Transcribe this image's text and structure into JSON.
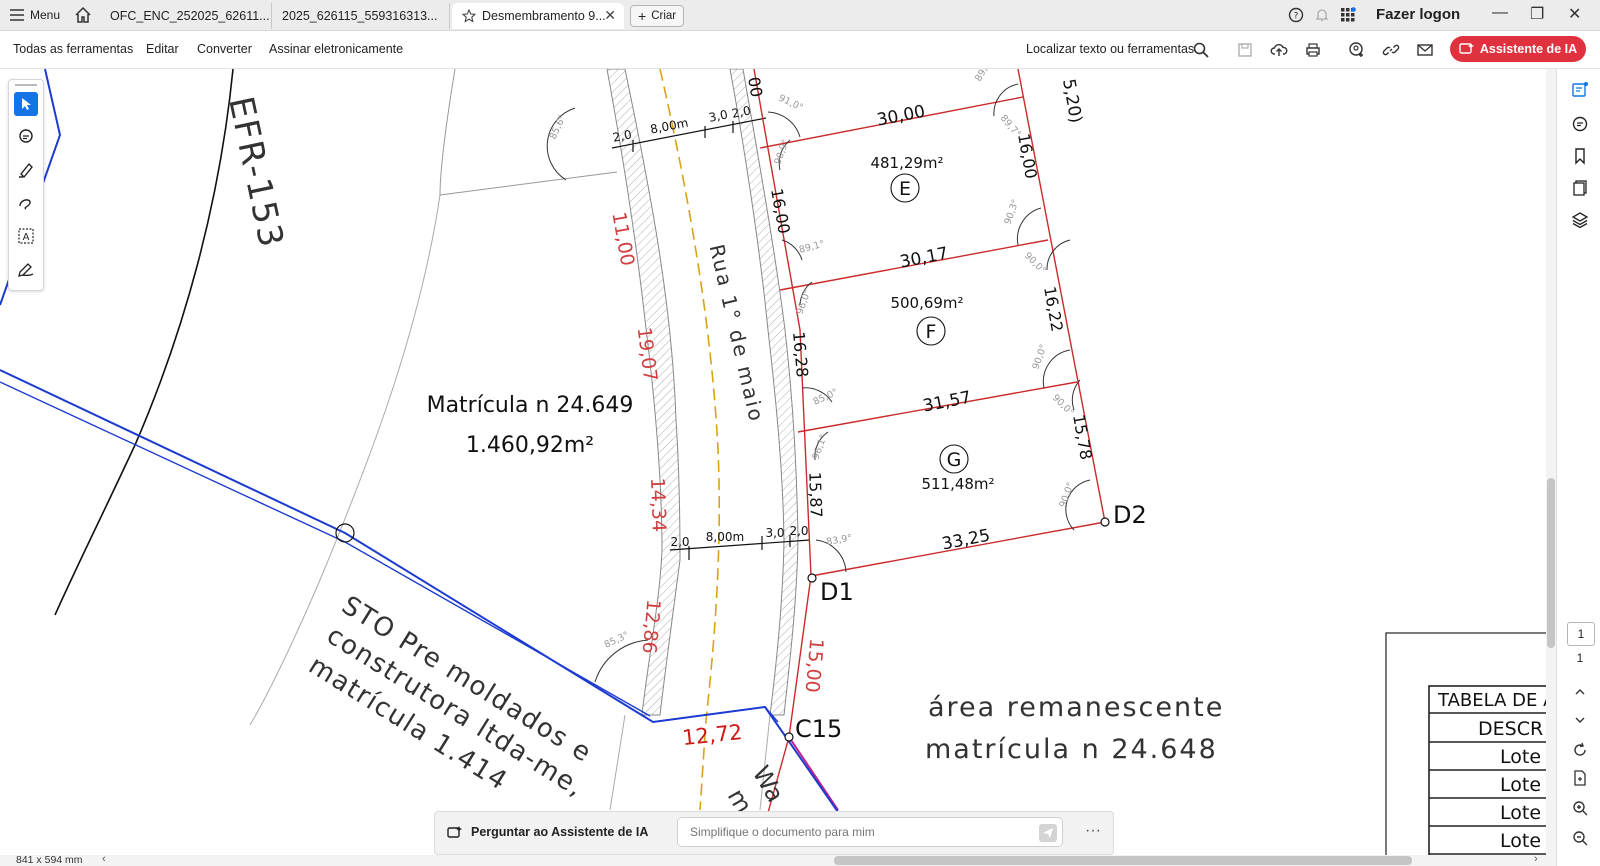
{
  "tabs": {
    "menu_label": "Menu",
    "items": [
      {
        "label": "OFC_ENC_252025_62611..."
      },
      {
        "label": "2025_626115_559316313..."
      },
      {
        "label": "Desmembramento 9..."
      }
    ],
    "new_tab_label": "Criar"
  },
  "account": {
    "login_label": "Fazer logon"
  },
  "toolbar": {
    "all_tools": "Todas as ferramentas",
    "edit": "Editar",
    "convert": "Converter",
    "sign": "Assinar eletronicamente",
    "find_label": "Localizar texto ou ferramentas",
    "ai_assistant": "Assistente de IA"
  },
  "drawing": {
    "road_label": "Rua 1° de maio",
    "left_parcel": {
      "title": "Matrícula n 24.649",
      "area": "1.460,92m²"
    },
    "efr": "EFR-153",
    "sto_lines": [
      "STO Pre moldados e",
      "construtora ltda-me,",
      "matrícula 1.414"
    ],
    "remaining_lines": [
      "área remanescente",
      "matrícula n 24.648"
    ],
    "lots": [
      {
        "letter": "E",
        "area": "481,29m²",
        "front": "30,00",
        "side_left": "16,00",
        "side_right": "16,00"
      },
      {
        "letter": "F",
        "area": "500,69m²",
        "front": "30,17",
        "side_left": "16,28",
        "side_right": "16,22"
      },
      {
        "letter": "G",
        "area": "511,48m²",
        "front": "31,57",
        "side_left": "15,87",
        "side_right": "15,78",
        "back": "33,25"
      }
    ],
    "points": {
      "d1": "D1",
      "d2": "D2",
      "c15": "C15"
    },
    "red_dims": [
      "11,00",
      "19,07",
      "14,34",
      "12,86",
      "15,00",
      "12,72"
    ],
    "road_widths_top": [
      "2,0",
      "8,00m",
      "3,0",
      "2,0"
    ],
    "road_widths_bottom": [
      "2,0",
      "8,00m",
      "3,0",
      "2,0"
    ],
    "angles": [
      "91,0°",
      "85,6°",
      "90,9°",
      "89,1°",
      "96,0°",
      "90,3°",
      "90,0°",
      "85,0°",
      "96,1°",
      "90,0°",
      "90,0°",
      "90,0°",
      "83,9°",
      "85,3°",
      "89,",
      "89,7°"
    ],
    "partial_top_right": "5,20)",
    "partial_top_left": "00",
    "partial_bottom_road": [
      "Wa",
      "m"
    ]
  },
  "table": {
    "title": "TABELA DE A",
    "header": "DESCR",
    "rows": [
      "Lote",
      "Lote",
      "Lote",
      "Lote"
    ]
  },
  "pages": {
    "current": "1",
    "total": "1"
  },
  "status": {
    "dimensions": "841 x 594 mm"
  },
  "ask": {
    "label": "Perguntar ao Assistente de IA",
    "placeholder": "Simplifique o documento para mim",
    "more": "···"
  },
  "colors": {
    "ai_red": "#e0313f",
    "lot_line": "#cc2a2a",
    "boundary_blue": "#1c3bd0",
    "active_tool": "#1473e6"
  }
}
